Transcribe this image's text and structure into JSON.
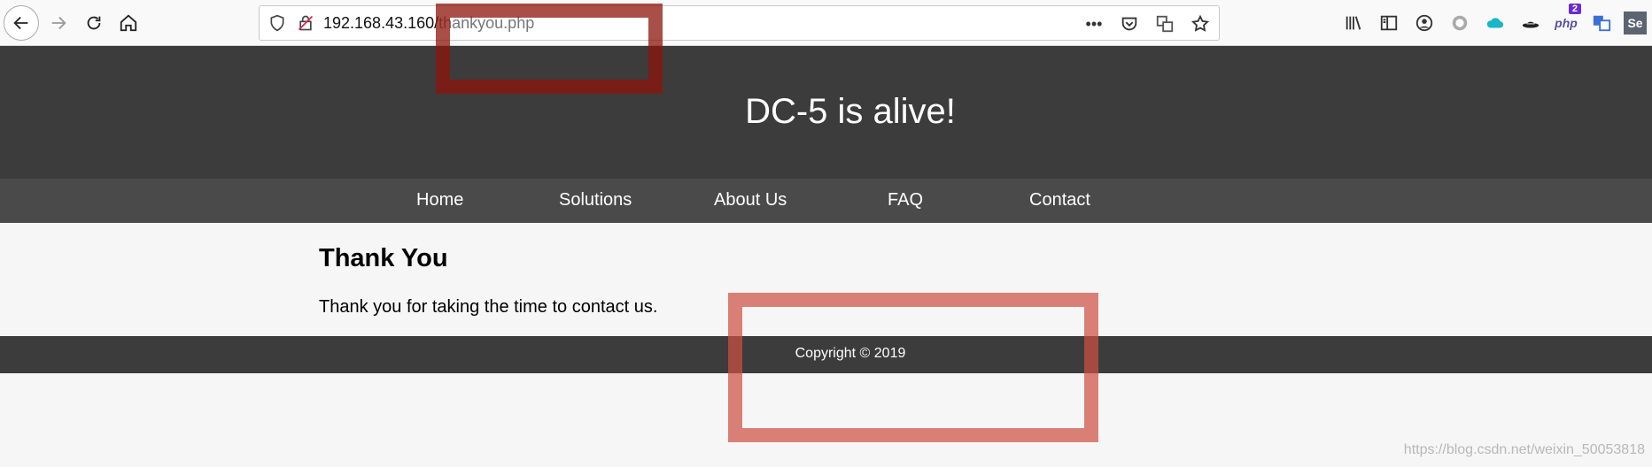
{
  "browser": {
    "url_host": "192.168.43.160/",
    "url_path": "thankyou.php",
    "overflow_label": "•••",
    "extensions": [
      {
        "name": "library-icon"
      },
      {
        "name": "sidebar-icon"
      },
      {
        "name": "account-icon"
      },
      {
        "name": "circle-icon"
      },
      {
        "name": "cloud-icon"
      },
      {
        "name": "hat-icon"
      },
      {
        "name": "php-icon",
        "label": "php",
        "badge": "2"
      },
      {
        "name": "translate-icon"
      },
      {
        "name": "selenium-icon",
        "label": "Se"
      }
    ]
  },
  "site": {
    "title": "DC-5 is alive!",
    "nav": [
      "Home",
      "Solutions",
      "About Us",
      "FAQ",
      "Contact"
    ],
    "heading": "Thank You",
    "message": "Thank you for taking the time to contact us.",
    "footer": "Copyright © 2019"
  },
  "watermark": "https://blog.csdn.net/weixin_50053818",
  "colors": {
    "header_bg": "#3c3c3c",
    "nav_bg": "#4a4a4a",
    "page_bg": "#f6f6f6",
    "annotation": "#c0392b"
  }
}
